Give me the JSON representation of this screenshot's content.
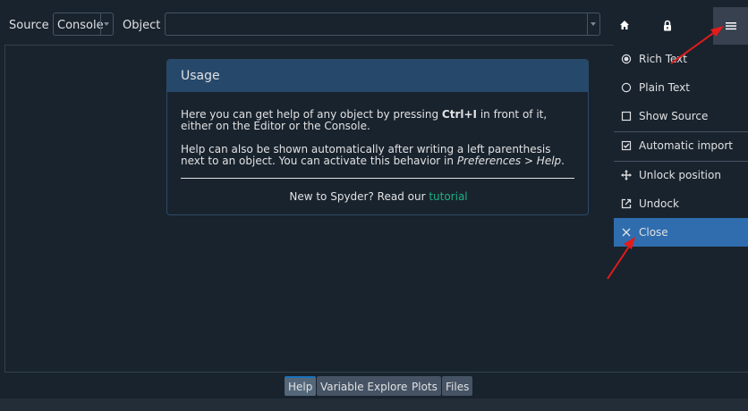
{
  "toolbar": {
    "source_label": "Source",
    "source_value": "Console",
    "object_label": "Object",
    "object_value": ""
  },
  "usage": {
    "title": "Usage",
    "p1_before": "Here you can get help of any object by pressing ",
    "p1_bold": "Ctrl+I",
    "p1_after": " in front of it, either on the Editor or the Console.",
    "p2_before": "Help can also be shown automatically after writing a left parenthesis next to an object. You can activate this behavior in ",
    "p2_italic": "Preferences > Help",
    "p2_after": ".",
    "tutorial_prefix": "New to Spyder? Read our ",
    "tutorial_link": "tutorial"
  },
  "menu": {
    "rich_text": "Rich Text",
    "plain_text": "Plain Text",
    "show_source": "Show Source",
    "automatic_import": "Automatic import",
    "unlock_position": "Unlock position",
    "undock": "Undock",
    "close": "Close"
  },
  "tabs": {
    "help": "Help",
    "variable_explorer": "Variable Explorer",
    "plots": "Plots",
    "files": "Files"
  },
  "colors": {
    "background": "#19232d",
    "accent": "#2f6dae",
    "link": "#1fb083",
    "annotation": "#e31b1b"
  }
}
